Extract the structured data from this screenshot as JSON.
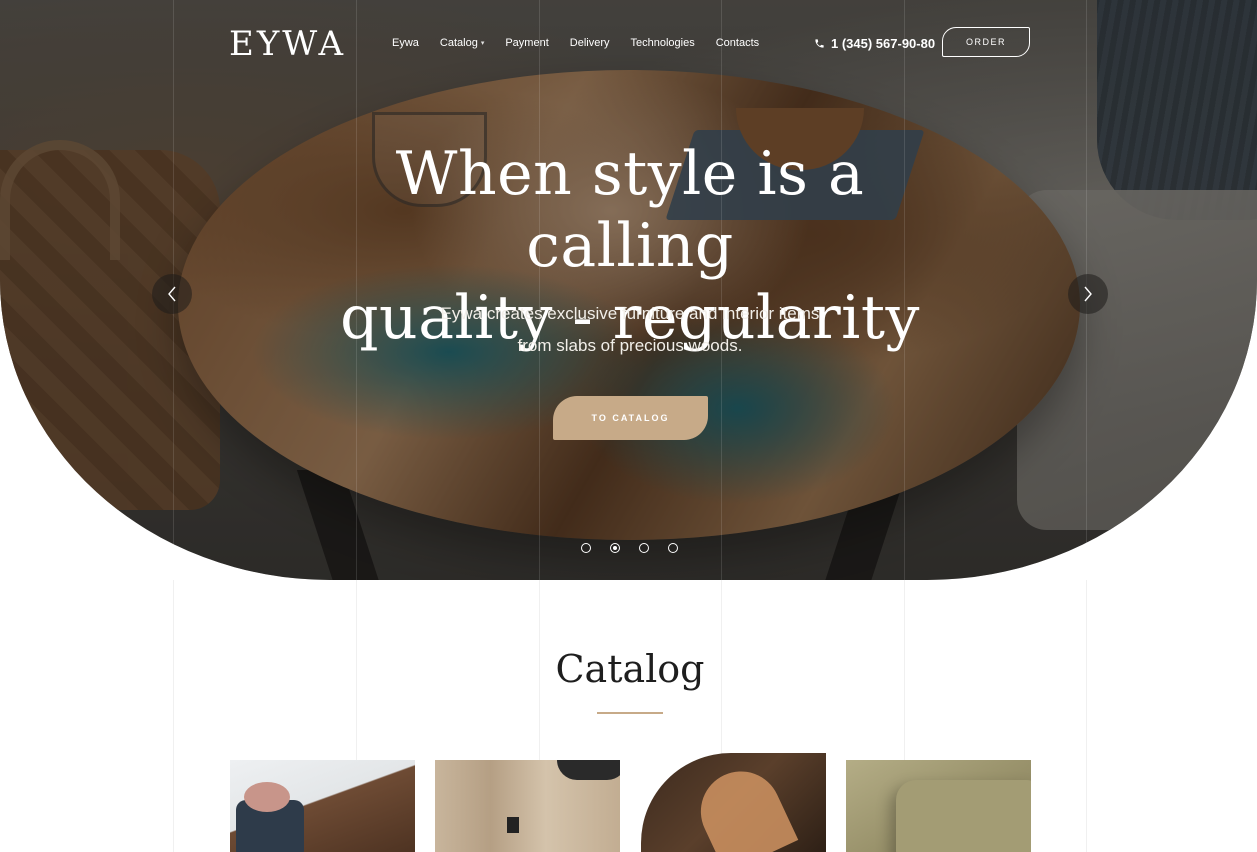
{
  "brand": {
    "logo": "EYWA"
  },
  "nav": {
    "items": [
      {
        "label": "Eywa"
      },
      {
        "label": "Catalog",
        "has_dropdown": true
      },
      {
        "label": "Payment"
      },
      {
        "label": "Delivery"
      },
      {
        "label": "Technologies"
      },
      {
        "label": "Contacts"
      }
    ],
    "phone": "1 (345) 567-90-80",
    "order_label": "ORDER"
  },
  "hero": {
    "title_line1": "When style is a calling",
    "title_line2": "quality - regularity",
    "subtitle_line1": "Eywa creates exclusive furniture and interior items",
    "subtitle_line2": "from slabs of precious woods.",
    "cta_label": "TO CATALOG",
    "slides_total": 4,
    "active_slide": 2
  },
  "catalog": {
    "title": "Catalog",
    "cards": 4
  },
  "colors": {
    "accent": "#c7aa88",
    "text_dark": "#1e1e1e",
    "white": "#ffffff"
  },
  "icons": [
    "phone-icon",
    "chevron-left-icon",
    "chevron-right-icon",
    "chevron-down-icon"
  ]
}
